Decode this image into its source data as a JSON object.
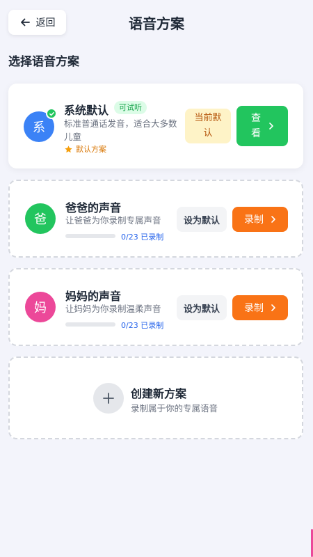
{
  "header": {
    "back_label": "返回",
    "title": "语音方案"
  },
  "section_title": "选择语音方案",
  "schemes": [
    {
      "avatar": "系",
      "avatar_color": "#3b82f6",
      "name": "系统默认",
      "tag": "可试听",
      "desc": "标准普通话发音，适合大多数儿童",
      "default_note": "默认方案",
      "status_label": "当前默认",
      "action_label": "查看"
    },
    {
      "avatar": "爸",
      "avatar_color": "#22c55e",
      "name": "爸爸的声音",
      "desc": "让爸爸为你录制专属声音",
      "progress": {
        "recorded": 0,
        "total": 23,
        "text": "0/23 已录制"
      },
      "set_label": "设为默认",
      "action_label": "录制"
    },
    {
      "avatar": "妈",
      "avatar_color": "#ec4899",
      "name": "妈妈的声音",
      "desc": "让妈妈为你录制温柔声音",
      "progress": {
        "recorded": 0,
        "total": 23,
        "text": "0/23 已录制"
      },
      "set_label": "设为默认",
      "action_label": "录制"
    }
  ],
  "create": {
    "title": "创建新方案",
    "subtitle": "录制属于你的专属语音"
  },
  "colors": {
    "primary_green": "#22c55e",
    "record_orange": "#f97316",
    "progress_blue": "#3b82f6",
    "warning_bg": "#fef3c7"
  }
}
